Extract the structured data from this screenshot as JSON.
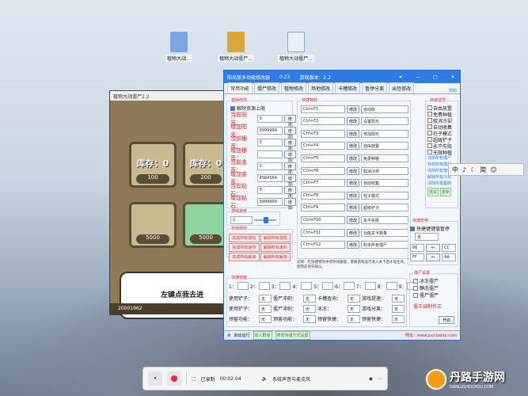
{
  "desktop": {
    "icons": [
      {
        "label": "植物大战...",
        "icon": "archive-icon"
      },
      {
        "label": "植物大战僵尸...",
        "icon": "rar-icon"
      },
      {
        "label": "植物大战僵尸...",
        "icon": "document-icon"
      }
    ]
  },
  "game": {
    "title": "植物大战僵尸2.2",
    "tile1_label": "库存：0",
    "tile1_num": "100",
    "tile2_label": "库存：0",
    "tile2_num": "200",
    "tile3_num": "5000",
    "tile4_num": "5000",
    "panel_text": "左键点我去进",
    "coins": "20001962"
  },
  "trainer": {
    "title": "阳光版多功能修改器",
    "version_short": "0.23",
    "game_version": "游戏版本：2.2",
    "tabs": [
      "常用功能",
      "僵尸修改",
      "植物修改",
      "场地修改",
      "卡槽修改",
      "暂停分离",
      "出怪修改"
    ],
    "help": "帮助",
    "basic_title": "基础修改",
    "unlock_limit": "解除资源上限",
    "fields": [
      {
        "label": "当前阳光：",
        "value": "0",
        "btn": "修改"
      },
      {
        "label": "增加阳光：",
        "value": "9999999",
        "btn": "增加"
      },
      {
        "label": "当前银币：",
        "value": "0",
        "btn": "修改"
      },
      {
        "label": "增加银币：",
        "value": "",
        "btn": "增加"
      },
      {
        "label": "当前金币：",
        "value": "0",
        "btn": "修改"
      },
      {
        "label": "增加金币：",
        "value": "4564564",
        "btn": "增加"
      },
      {
        "label": "当前钻石：",
        "value": "0",
        "btn": "修改"
      },
      {
        "label": "增加钻石：",
        "value": "9999999",
        "btn": "增加"
      }
    ],
    "speed_title": "游戏速度",
    "speed_value": "1",
    "pause_title": "存档修改",
    "pause_btns": [
      "完成所有冒险",
      "解锁所有冒险",
      "完成所有迷你",
      "解锁所有迷你",
      "完成所有解谜",
      "解锁所有解谜"
    ],
    "hotkey_title": "快捷特效",
    "hotkeys": [
      {
        "key": "Ctrl+F1",
        "btn": "修改",
        "action": "自动收"
      },
      {
        "key": "Ctrl+F2",
        "btn": "修改",
        "action": "设置阳光"
      },
      {
        "key": "Ctrl+F3",
        "btn": "修改",
        "action": "增加阳光"
      },
      {
        "key": "Ctrl+F4",
        "btn": "修改",
        "action": "自由放置"
      },
      {
        "key": "Ctrl+F5",
        "btn": "修改",
        "action": "免费种植"
      },
      {
        "key": "Ctrl+F6",
        "btn": "修改",
        "action": "取消冷却"
      },
      {
        "key": "Ctrl+F7",
        "btn": "修改",
        "action": "自动收集"
      },
      {
        "key": "Ctrl+F8",
        "btn": "修改",
        "action": "柱子模式"
      },
      {
        "key": "Ctrl+F9",
        "btn": "修改",
        "action": "超级铲子"
      },
      {
        "key": "Ctrl+F10",
        "btn": "修改",
        "action": "永不失败"
      },
      {
        "key": "Ctrl+F11",
        "btn": "修改",
        "action": "功能关卡数量"
      },
      {
        "key": "Ctrl+F12",
        "btn": "修改",
        "action": "秒杀所有僵尸"
      }
    ],
    "quick_title": "快速选项",
    "quick_items": [
      "自由放置",
      "免费种植",
      "取消冷却",
      "自动收集",
      "柱子模式",
      "超级铲子",
      "永不失败",
      "无限种植"
    ],
    "quick_btns": [
      "清除所有僵尸",
      "秒杀所有僵尸",
      "清除所有植物",
      "解除所有冷却",
      "清除所有墓碑"
    ],
    "quick_small": [
      "选关",
      "更新"
    ],
    "card_title": "快捷暂停",
    "card_lbl": "快捷键键值暂停",
    "card_sel": "无",
    "card_values": [
      "66",
      "CC",
      "FF",
      "AA"
    ],
    "note": "说明：在快捷特效中修改快捷键，需要游戏运行进入关卡后才能生效，使用前请先确认。",
    "hotkey2_title": "快捷按键",
    "hotkey_row_labels": [
      "1：",
      "2：",
      "3：",
      "4：",
      "5：",
      "6：",
      "7：",
      "8：",
      "9："
    ],
    "bottom_rows": [
      {
        "a": "使用铲子：",
        "b": "无",
        "c": "僵尸冲刺：",
        "d": "无",
        "e": "卡槽查询：",
        "f": "无",
        "g": "游戏提速：",
        "h": "无"
      },
      {
        "a": "使用铲子：",
        "b": "无",
        "c": "僵尸冲刺：",
        "d": "无",
        "e": "冰冻：",
        "f": "无",
        "g": "游戏分离：",
        "h": "无"
      },
      {
        "a": "预留功能：",
        "b": "无",
        "c": "预留功能：",
        "d": "无",
        "e": "预留快捷：",
        "f": "无",
        "g": "预留快捷：",
        "h": "无"
      }
    ],
    "side_title": "僵尸设置",
    "side_items": [
      "冰冻僵尸",
      "静态僵尸",
      "僵尸僵尸"
    ],
    "side_note": "僵王战制作正",
    "open_label": "开启",
    "status_items": [
      "启动运行",
      "加入群组",
      "修改快捷方式设置"
    ],
    "status_url": "网址：www.pvz.baidu.com"
  },
  "recorder": {
    "status": "已录制",
    "time": "00:02:04",
    "audio": "系统声音与麦克风"
  },
  "ime": {
    "items": [
      "中",
      "♪",
      "☾",
      "简",
      "☺"
    ]
  },
  "watermark": {
    "brand": "丹路手游网",
    "domain": "DANLUSHOUYOU.COM"
  }
}
